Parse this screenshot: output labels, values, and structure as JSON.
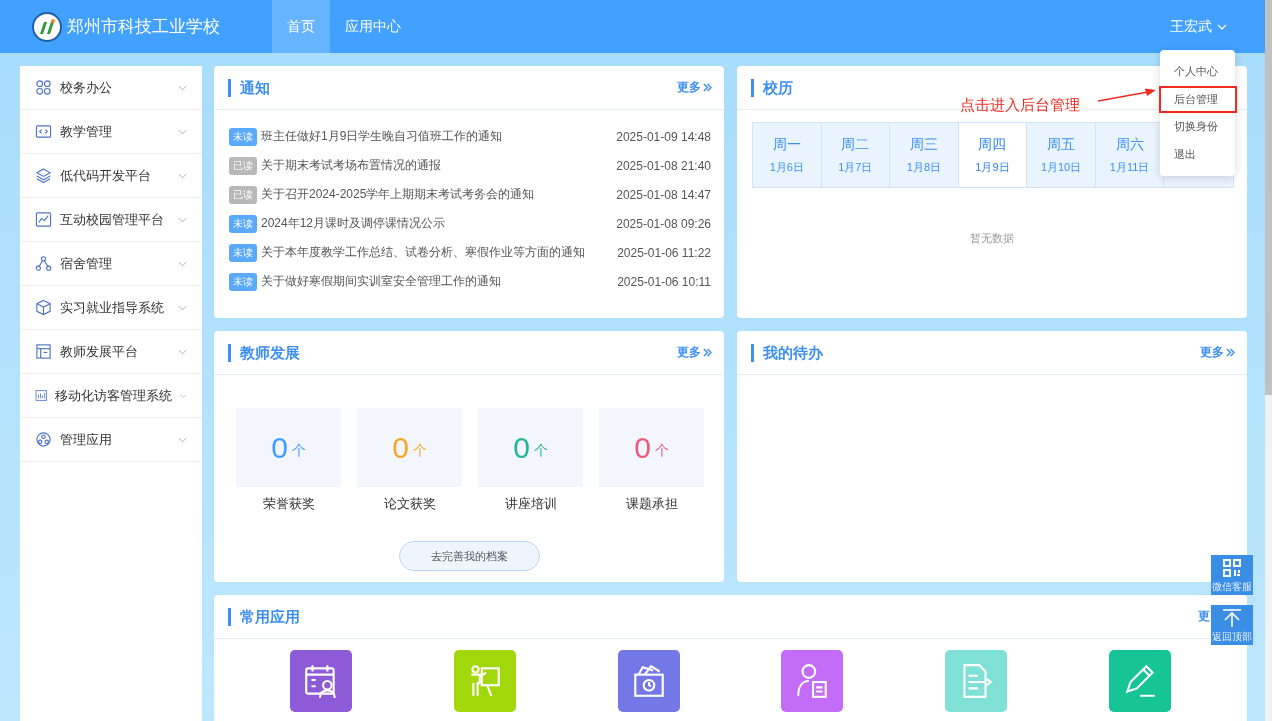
{
  "header": {
    "school_name": "郑州市科技工业学校",
    "nav": [
      {
        "label": "首页",
        "selected": true
      },
      {
        "label": "应用中心",
        "selected": false
      }
    ],
    "user": "王宏武"
  },
  "user_menu": {
    "items": [
      {
        "label": "个人中心",
        "highlighted": false
      },
      {
        "label": "后台管理",
        "highlighted": true
      },
      {
        "label": "切换身份",
        "highlighted": false
      },
      {
        "label": "退出",
        "highlighted": false
      }
    ]
  },
  "annotation": "点击进入后台管理",
  "sidebar": {
    "items": [
      {
        "label": "校务办公"
      },
      {
        "label": "教学管理"
      },
      {
        "label": "低代码开发平台"
      },
      {
        "label": "互动校园管理平台"
      },
      {
        "label": "宿舍管理"
      },
      {
        "label": "实习就业指导系统"
      },
      {
        "label": "教师发展平台"
      },
      {
        "label": "移动化访客管理系统"
      },
      {
        "label": "管理应用"
      }
    ]
  },
  "notices": {
    "title": "通知",
    "more": "更多",
    "items": [
      {
        "status": "未读",
        "read": false,
        "title": "班主任做好1月9日学生晚自习值班工作的通知",
        "time": "2025-01-09 14:48"
      },
      {
        "status": "已读",
        "read": true,
        "title": "关于期末考试考场布置情况的通报",
        "time": "2025-01-08 21:40"
      },
      {
        "status": "已读",
        "read": true,
        "title": "关于召开2024-2025学年上期期末考试考务会的通知",
        "time": "2025-01-08 14:47"
      },
      {
        "status": "未读",
        "read": false,
        "title": "2024年12月课时及调停课情况公示",
        "time": "2025-01-08 09:26"
      },
      {
        "status": "未读",
        "read": false,
        "title": "关于本年度教学工作总结、试卷分析、寒假作业等方面的通知",
        "time": "2025-01-06 11:22"
      },
      {
        "status": "未读",
        "read": false,
        "title": "关于做好寒假期间实训室安全管理工作的通知",
        "time": "2025-01-06 10:11"
      }
    ]
  },
  "calendar": {
    "title": "校历",
    "days": [
      {
        "weekday": "周一",
        "date": "1月6日",
        "selected": false
      },
      {
        "weekday": "周二",
        "date": "1月7日",
        "selected": false
      },
      {
        "weekday": "周三",
        "date": "1月8日",
        "selected": false
      },
      {
        "weekday": "周四",
        "date": "1月9日",
        "selected": true
      },
      {
        "weekday": "周五",
        "date": "1月10日",
        "selected": false
      },
      {
        "weekday": "周六",
        "date": "1月11日",
        "selected": false
      },
      {
        "selected": false
      }
    ],
    "empty_text": "暂无数据"
  },
  "teacher_dev": {
    "title": "教师发展",
    "more": "更多",
    "stats": [
      {
        "value": "0",
        "unit": "个",
        "label": "荣誉获奖",
        "color": "#409eff"
      },
      {
        "value": "0",
        "unit": "个",
        "label": "论文获奖",
        "color": "#f5a623"
      },
      {
        "value": "0",
        "unit": "个",
        "label": "讲座培训",
        "color": "#26b39c"
      },
      {
        "value": "0",
        "unit": "个",
        "label": "课题承担",
        "color": "#f0587a"
      }
    ],
    "button": "去完善我的档案"
  },
  "todo": {
    "title": "我的待办",
    "more": "更多"
  },
  "apps": {
    "title": "常用应用",
    "more": "更",
    "items": [
      {
        "kind": "schedule",
        "color": "#8e5bd8"
      },
      {
        "kind": "lecture",
        "color": "#a2d80a"
      },
      {
        "kind": "attendance",
        "color": "#7378e6"
      },
      {
        "kind": "profile",
        "color": "#c36cf7"
      },
      {
        "kind": "export",
        "color": "#7fe0d5"
      },
      {
        "kind": "edit",
        "color": "#16c495"
      }
    ]
  },
  "float_buttons": [
    {
      "kind": "qr",
      "label": "微信客服"
    },
    {
      "kind": "top",
      "label": "返回顶部"
    }
  ]
}
